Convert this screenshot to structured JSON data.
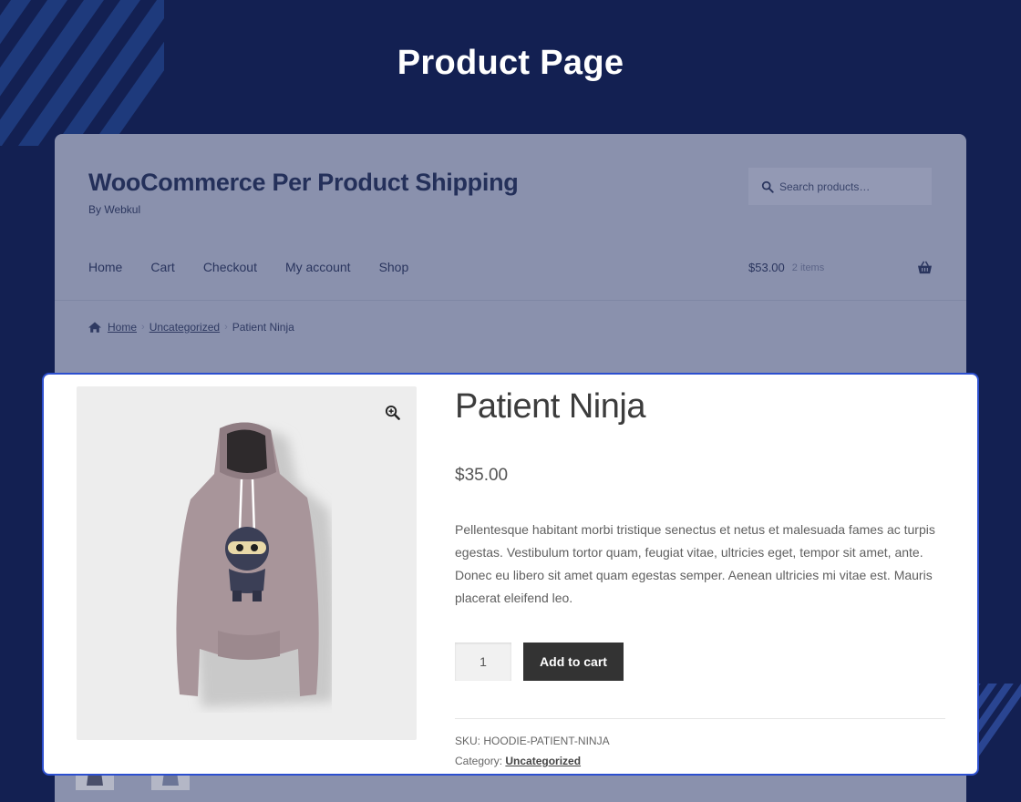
{
  "page": {
    "heading": "Product Page"
  },
  "header": {
    "site_title": "WooCommerce Per Product Shipping",
    "tagline": "By Webkul",
    "search_placeholder": "Search products…"
  },
  "nav": {
    "items": [
      "Home",
      "Cart",
      "Checkout",
      "My account",
      "Shop"
    ]
  },
  "cart": {
    "total": "$53.00",
    "count": "2 items"
  },
  "breadcrumb": {
    "home": "Home",
    "separator": "›",
    "category": "Uncategorized",
    "current": "Patient Ninja"
  },
  "product": {
    "title": "Patient Ninja",
    "price": "$35.00",
    "description": "Pellentesque habitant morbi tristique senectus et netus et malesuada fames ac turpis egestas. Vestibulum tortor quam, feugiat vitae, ultricies eget, tempor sit amet, ante. Donec eu libero sit amet quam egestas semper. Aenean ultricies mi vitae est. Mauris placerat eleifend leo.",
    "quantity": "1",
    "add_to_cart_label": "Add to cart",
    "sku_label": "SKU:",
    "sku": "HOODIE-PATIENT-NINJA",
    "category_label": "Category:",
    "category": "Uncategorized"
  },
  "colors": {
    "background": "#132052",
    "highlight_border": "#2c4fcf",
    "button": "#333333"
  },
  "icons": [
    "search-icon",
    "basket-icon",
    "home-icon",
    "zoom-icon"
  ]
}
